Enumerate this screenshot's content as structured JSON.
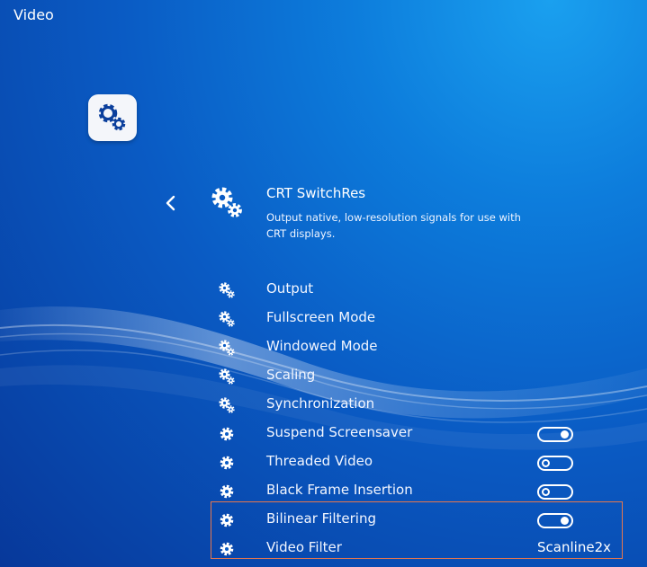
{
  "window": {
    "title": "Video"
  },
  "header": {
    "title": "CRT SwitchRes",
    "description": "Output native, low-resolution signals for use with CRT displays."
  },
  "icons": {
    "app": "settings-gears-icon",
    "back": "chevron-left-icon",
    "submenu": "gears-icon",
    "setting": "gear-icon"
  },
  "colors": {
    "background_top": "#1aa0ef",
    "background_bottom": "#07389a",
    "selection_border": "#e6774e"
  },
  "items": [
    {
      "label": "Output",
      "icon": "gears-icon",
      "kind": "submenu"
    },
    {
      "label": "Fullscreen Mode",
      "icon": "gears-icon",
      "kind": "submenu"
    },
    {
      "label": "Windowed Mode",
      "icon": "gears-icon",
      "kind": "submenu"
    },
    {
      "label": "Scaling",
      "icon": "gears-icon",
      "kind": "submenu"
    },
    {
      "label": "Synchronization",
      "icon": "gears-icon",
      "kind": "submenu"
    },
    {
      "label": "Suspend Screensaver",
      "icon": "gear-icon",
      "kind": "toggle",
      "state": "on"
    },
    {
      "label": "Threaded Video",
      "icon": "gear-icon",
      "kind": "toggle",
      "state": "off"
    },
    {
      "label": "Black Frame Insertion",
      "icon": "gear-icon",
      "kind": "toggle",
      "state": "off"
    },
    {
      "label": "Bilinear Filtering",
      "icon": "gear-icon",
      "kind": "toggle",
      "state": "on",
      "selected": true
    },
    {
      "label": "Video Filter",
      "icon": "gear-icon",
      "kind": "value",
      "value": "Scanline2x",
      "selected": true
    }
  ]
}
